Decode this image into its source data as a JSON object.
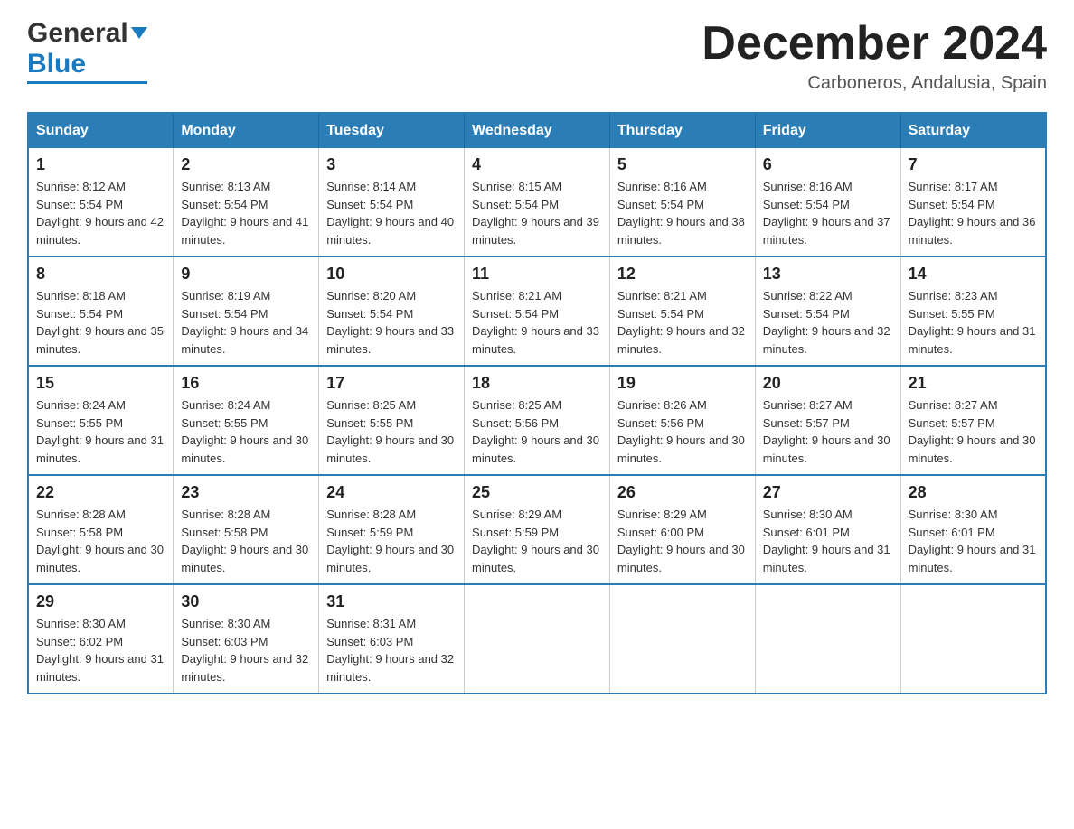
{
  "header": {
    "logo_general": "General",
    "logo_blue": "Blue",
    "month_title": "December 2024",
    "location": "Carboneros, Andalusia, Spain"
  },
  "days_of_week": [
    "Sunday",
    "Monday",
    "Tuesday",
    "Wednesday",
    "Thursday",
    "Friday",
    "Saturday"
  ],
  "weeks": [
    [
      {
        "day": "1",
        "sunrise": "Sunrise: 8:12 AM",
        "sunset": "Sunset: 5:54 PM",
        "daylight": "Daylight: 9 hours and 42 minutes."
      },
      {
        "day": "2",
        "sunrise": "Sunrise: 8:13 AM",
        "sunset": "Sunset: 5:54 PM",
        "daylight": "Daylight: 9 hours and 41 minutes."
      },
      {
        "day": "3",
        "sunrise": "Sunrise: 8:14 AM",
        "sunset": "Sunset: 5:54 PM",
        "daylight": "Daylight: 9 hours and 40 minutes."
      },
      {
        "day": "4",
        "sunrise": "Sunrise: 8:15 AM",
        "sunset": "Sunset: 5:54 PM",
        "daylight": "Daylight: 9 hours and 39 minutes."
      },
      {
        "day": "5",
        "sunrise": "Sunrise: 8:16 AM",
        "sunset": "Sunset: 5:54 PM",
        "daylight": "Daylight: 9 hours and 38 minutes."
      },
      {
        "day": "6",
        "sunrise": "Sunrise: 8:16 AM",
        "sunset": "Sunset: 5:54 PM",
        "daylight": "Daylight: 9 hours and 37 minutes."
      },
      {
        "day": "7",
        "sunrise": "Sunrise: 8:17 AM",
        "sunset": "Sunset: 5:54 PM",
        "daylight": "Daylight: 9 hours and 36 minutes."
      }
    ],
    [
      {
        "day": "8",
        "sunrise": "Sunrise: 8:18 AM",
        "sunset": "Sunset: 5:54 PM",
        "daylight": "Daylight: 9 hours and 35 minutes."
      },
      {
        "day": "9",
        "sunrise": "Sunrise: 8:19 AM",
        "sunset": "Sunset: 5:54 PM",
        "daylight": "Daylight: 9 hours and 34 minutes."
      },
      {
        "day": "10",
        "sunrise": "Sunrise: 8:20 AM",
        "sunset": "Sunset: 5:54 PM",
        "daylight": "Daylight: 9 hours and 33 minutes."
      },
      {
        "day": "11",
        "sunrise": "Sunrise: 8:21 AM",
        "sunset": "Sunset: 5:54 PM",
        "daylight": "Daylight: 9 hours and 33 minutes."
      },
      {
        "day": "12",
        "sunrise": "Sunrise: 8:21 AM",
        "sunset": "Sunset: 5:54 PM",
        "daylight": "Daylight: 9 hours and 32 minutes."
      },
      {
        "day": "13",
        "sunrise": "Sunrise: 8:22 AM",
        "sunset": "Sunset: 5:54 PM",
        "daylight": "Daylight: 9 hours and 32 minutes."
      },
      {
        "day": "14",
        "sunrise": "Sunrise: 8:23 AM",
        "sunset": "Sunset: 5:55 PM",
        "daylight": "Daylight: 9 hours and 31 minutes."
      }
    ],
    [
      {
        "day": "15",
        "sunrise": "Sunrise: 8:24 AM",
        "sunset": "Sunset: 5:55 PM",
        "daylight": "Daylight: 9 hours and 31 minutes."
      },
      {
        "day": "16",
        "sunrise": "Sunrise: 8:24 AM",
        "sunset": "Sunset: 5:55 PM",
        "daylight": "Daylight: 9 hours and 30 minutes."
      },
      {
        "day": "17",
        "sunrise": "Sunrise: 8:25 AM",
        "sunset": "Sunset: 5:55 PM",
        "daylight": "Daylight: 9 hours and 30 minutes."
      },
      {
        "day": "18",
        "sunrise": "Sunrise: 8:25 AM",
        "sunset": "Sunset: 5:56 PM",
        "daylight": "Daylight: 9 hours and 30 minutes."
      },
      {
        "day": "19",
        "sunrise": "Sunrise: 8:26 AM",
        "sunset": "Sunset: 5:56 PM",
        "daylight": "Daylight: 9 hours and 30 minutes."
      },
      {
        "day": "20",
        "sunrise": "Sunrise: 8:27 AM",
        "sunset": "Sunset: 5:57 PM",
        "daylight": "Daylight: 9 hours and 30 minutes."
      },
      {
        "day": "21",
        "sunrise": "Sunrise: 8:27 AM",
        "sunset": "Sunset: 5:57 PM",
        "daylight": "Daylight: 9 hours and 30 minutes."
      }
    ],
    [
      {
        "day": "22",
        "sunrise": "Sunrise: 8:28 AM",
        "sunset": "Sunset: 5:58 PM",
        "daylight": "Daylight: 9 hours and 30 minutes."
      },
      {
        "day": "23",
        "sunrise": "Sunrise: 8:28 AM",
        "sunset": "Sunset: 5:58 PM",
        "daylight": "Daylight: 9 hours and 30 minutes."
      },
      {
        "day": "24",
        "sunrise": "Sunrise: 8:28 AM",
        "sunset": "Sunset: 5:59 PM",
        "daylight": "Daylight: 9 hours and 30 minutes."
      },
      {
        "day": "25",
        "sunrise": "Sunrise: 8:29 AM",
        "sunset": "Sunset: 5:59 PM",
        "daylight": "Daylight: 9 hours and 30 minutes."
      },
      {
        "day": "26",
        "sunrise": "Sunrise: 8:29 AM",
        "sunset": "Sunset: 6:00 PM",
        "daylight": "Daylight: 9 hours and 30 minutes."
      },
      {
        "day": "27",
        "sunrise": "Sunrise: 8:30 AM",
        "sunset": "Sunset: 6:01 PM",
        "daylight": "Daylight: 9 hours and 31 minutes."
      },
      {
        "day": "28",
        "sunrise": "Sunrise: 8:30 AM",
        "sunset": "Sunset: 6:01 PM",
        "daylight": "Daylight: 9 hours and 31 minutes."
      }
    ],
    [
      {
        "day": "29",
        "sunrise": "Sunrise: 8:30 AM",
        "sunset": "Sunset: 6:02 PM",
        "daylight": "Daylight: 9 hours and 31 minutes."
      },
      {
        "day": "30",
        "sunrise": "Sunrise: 8:30 AM",
        "sunset": "Sunset: 6:03 PM",
        "daylight": "Daylight: 9 hours and 32 minutes."
      },
      {
        "day": "31",
        "sunrise": "Sunrise: 8:31 AM",
        "sunset": "Sunset: 6:03 PM",
        "daylight": "Daylight: 9 hours and 32 minutes."
      },
      null,
      null,
      null,
      null
    ]
  ]
}
